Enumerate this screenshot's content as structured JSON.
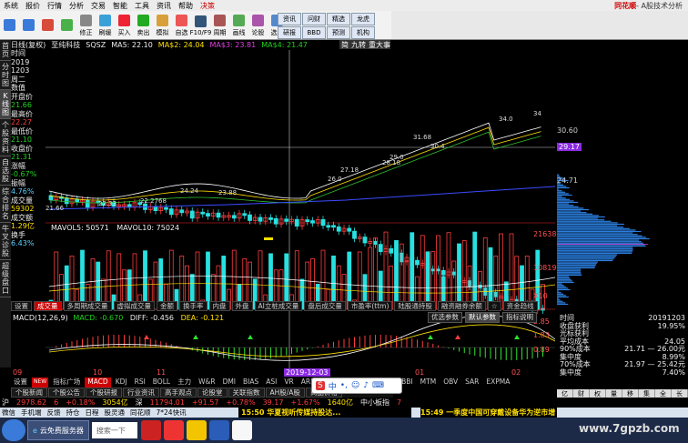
{
  "menubar": {
    "items": [
      "系统",
      "报价",
      "行情",
      "分析",
      "交易",
      "智能",
      "工具",
      "资讯",
      "帮助",
      "决策"
    ],
    "brand": "同花顺",
    "subtitle": "- A股技术分析"
  },
  "toolbar": {
    "buttons": [
      "",
      "",
      "",
      "",
      "修正",
      "刷缓",
      "买入",
      "卖出",
      "模拟",
      "自选",
      "F10/F9",
      "周期",
      "画线",
      "论股",
      "选股"
    ]
  },
  "toolbar_right": {
    "buttons": [
      "资讯",
      "问财",
      "精选",
      "龙虎",
      "研报",
      "BBD",
      "预测",
      "机构"
    ]
  },
  "leftbar": {
    "tabs": [
      "首页",
      "分时图",
      "K线图",
      "个股资料",
      "自选股",
      "综合排名",
      "牛叉诊股",
      "超级盘口"
    ],
    "active_index": 2
  },
  "chart_header": {
    "stock": "日线(复权)",
    "indicator_name": "至纯科技",
    "ma_title": "SQSZ",
    "ma1": "MA5: 22.10",
    "ma2": "MA$2: 24.04",
    "ma3": "MA$3: 23.81",
    "ma4": "MA$4: 21.47"
  },
  "right_topbar": {
    "labels": [
      "简",
      "九转",
      "重大事"
    ]
  },
  "info_panel": [
    {
      "label": "时间",
      "value": "2019",
      "color": "white"
    },
    {
      "label": "",
      "value": "1203",
      "color": "white"
    },
    {
      "label": "周二",
      "value": "",
      "color": "white"
    },
    {
      "label": "数值",
      "value": "",
      "color": "white"
    },
    {
      "label": "开盘价",
      "value": "21.66",
      "color": "green"
    },
    {
      "label": "最高价",
      "value": "22.27",
      "color": "red"
    },
    {
      "label": "最低价",
      "value": "21.10",
      "color": "green"
    },
    {
      "label": "收盘价",
      "value": "21.31",
      "color": "green"
    },
    {
      "label": "涨幅",
      "value": "-0.67%",
      "color": "green"
    },
    {
      "label": "振幅",
      "value": "4.76%",
      "color": "cyan"
    },
    {
      "label": "成交量",
      "value": "59302",
      "color": "yellow"
    },
    {
      "label": "成交额",
      "value": "1.29亿",
      "color": "yellow"
    },
    {
      "label": "换手",
      "value": "6.43%",
      "color": "cyan"
    }
  ],
  "volume_header": {
    "v1": "MAVOL5: 50571",
    "v2": "MAVOL10: 75024"
  },
  "macd_header": {
    "title": "MACD(12,26,9)",
    "macd": "MACD: -0.670",
    "diff": "DIFF: -0.456",
    "dea": "DEA: -0.121"
  },
  "subtabs": [
    "设置",
    "成交量",
    "多周期成交量",
    "虚拟成交量",
    "金额",
    "换手率",
    "内盘",
    "外盘",
    "AI立桩成交量",
    "盘后成交量",
    "市盈率(ttm)",
    "陆股通持股",
    "融资融券余额",
    "☆",
    "资金趋线"
  ],
  "subtabs_active": 1,
  "float_buttons": [
    "优选参数",
    "默认参数",
    "指标说明"
  ],
  "xaxis": [
    "09",
    "10",
    "11",
    "2019-12-03",
    "01",
    "02"
  ],
  "ind_tabs": [
    "设置",
    "NEW",
    "指标广场",
    "MACD",
    "KDJ",
    "RSI",
    "BOLL",
    "主力",
    "W&R",
    "DMI",
    "BIAS",
    "ASI",
    "VR",
    "ARBR",
    "DPO",
    "TRIX",
    "新CMA",
    "BBI",
    "MTM",
    "OBV",
    "SAR",
    "EXPMA"
  ],
  "ind_active": "MACD",
  "main_tabs": [
    "个股新闻",
    "个股公告",
    "个股研报",
    "行业资讯",
    "高手观点",
    "论股堂",
    "关联指数",
    "AH股/A股",
    "商品价格"
  ],
  "price_axis": [
    "30.60",
    "29.17",
    "24.71"
  ],
  "price_labels": {
    "high": "34.0",
    "p1": "31.68",
    "p2": "30.4",
    "p3": "29.0",
    "p4": "28.18",
    "p5": "27.18",
    "p6": "26.0",
    "p7": "23.88",
    "p8": "22.33",
    "p9": "22.2768",
    "p10": "21.66",
    "p11": "24.24",
    "p12": "34"
  },
  "vol_axis": [
    "21638",
    "10819",
    "X10"
  ],
  "macd_axis": [
    "2.85",
    "1.83",
    "0.89"
  ],
  "stats": [
    {
      "k": "时间",
      "v": "20191203",
      "color": "white"
    },
    {
      "k": "收盘获利",
      "v": "19.95%",
      "color": "white"
    },
    {
      "k": "光标获利",
      "v": "",
      "color": "white"
    },
    {
      "k": "平均成本",
      "v": "24.05",
      "color": "white"
    },
    {
      "k": "90%成本",
      "v": "21.71 — 26.00元",
      "color": "white"
    },
    {
      "k": "集中度",
      "v": "8.99%",
      "color": "white"
    },
    {
      "k": "70%成本",
      "v": "21.97 — 25.42元",
      "color": "white"
    },
    {
      "k": "集中度",
      "v": "7.40%",
      "color": "white"
    }
  ],
  "right_tabs": [
    "亿",
    "财",
    "权",
    "量",
    "移",
    "集",
    "全",
    "长"
  ],
  "ticker": [
    {
      "t": "沪",
      "c": "white"
    },
    {
      "t": "2978.62",
      "c": "red"
    },
    {
      "t": "6",
      "c": "red"
    },
    {
      "t": "+0.18%",
      "c": "red"
    },
    {
      "t": "3054亿",
      "c": "yellow"
    },
    {
      "t": "深",
      "c": "white"
    },
    {
      "t": "11794.01",
      "c": "red"
    },
    {
      "t": "+91.57",
      "c": "red"
    },
    {
      "t": "+0.78%",
      "c": "red"
    },
    {
      "t": "39.17",
      "c": "red"
    },
    {
      "t": "+1.67%",
      "c": "red"
    },
    {
      "t": "1640亿",
      "c": "yellow"
    },
    {
      "t": "中小板指",
      "c": "white"
    },
    {
      "t": "7",
      "c": "red"
    }
  ],
  "ticker2": [
    "微信",
    "手机端",
    "反馈",
    "持仓",
    "日程",
    "股灵通",
    "同花顺",
    "7*24快讯"
  ],
  "news": {
    "n1": "15:50 华夏视听传媒持股达...",
    "n2": "15:49 一季度中国可穿戴设备华为逆市增"
  },
  "ime": {
    "label": "中"
  },
  "taskbar": {
    "tasks": [
      "云免费服务器",
      "搜索一下"
    ]
  },
  "watermark": "www.7gpzb.com",
  "chart_data": {
    "type": "line",
    "title": "SQSZ",
    "x": [
      "09",
      "10",
      "11",
      "2019-12-03",
      "01",
      "02"
    ],
    "xlabel": "",
    "ylabel": "",
    "ylim": [
      21.0,
      36.0
    ],
    "price_levels": [
      30.6,
      29.17,
      24.71
    ]
  }
}
